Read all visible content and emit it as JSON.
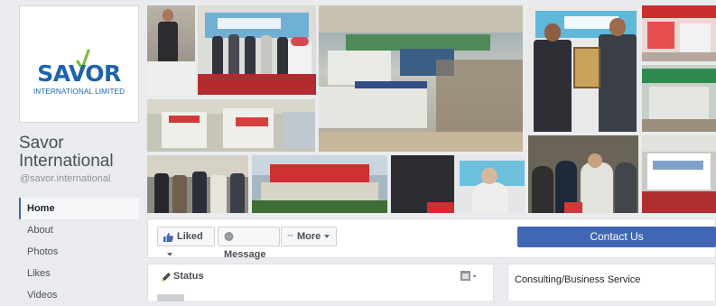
{
  "page": {
    "name": "Savor International",
    "handle": "@savor.international",
    "logo_word": "SAVOR",
    "logo_subtitle": "INTERNATIONAL LIMITED"
  },
  "nav": [
    {
      "label": "Home",
      "active": true
    },
    {
      "label": "About",
      "active": false
    },
    {
      "label": "Photos",
      "active": false
    },
    {
      "label": "Likes",
      "active": false
    },
    {
      "label": "Videos",
      "active": false
    }
  ],
  "cover": {
    "banner_texts": [
      "SAFECON 2018",
      "SAFECON",
      "EXPO",
      "SAFECON"
    ]
  },
  "actions": {
    "liked_label": "Liked",
    "message_label": "Message",
    "more_label": "More",
    "contact_label": "Contact Us"
  },
  "composer": {
    "status_label": "Status"
  },
  "sidebar_card": {
    "category": "Consulting/Business Service"
  },
  "colors": {
    "brand_blue": "#1d64ad",
    "facebook_blue": "#4267b2",
    "background": "#e9ebee"
  }
}
